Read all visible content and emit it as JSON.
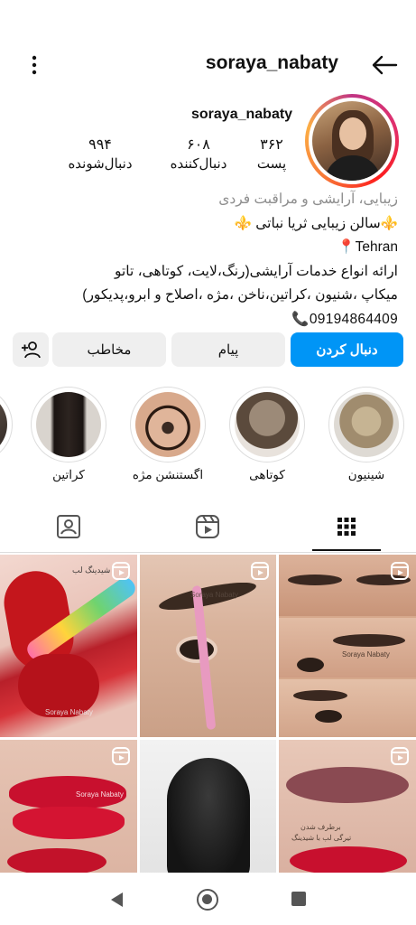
{
  "header": {
    "title": "soraya_nabaty",
    "menu_icon": "more-vertical-icon",
    "back_icon": "arrow-left-icon"
  },
  "profile": {
    "username": "soraya_nabaty",
    "stats": [
      {
        "value": "۳۶۲",
        "label": "پست"
      },
      {
        "value": "۶۰۸",
        "label": "دنبال‌کننده"
      },
      {
        "value": "۹۹۴",
        "label": "دنبال‌شونده"
      }
    ]
  },
  "bio": {
    "category": "زیبایی، آرایشی و مراقبت فردی",
    "line1": "⚜️سالن زیبایی ثریا نباتی ⚜️",
    "line2": "Tehran📍",
    "line3": "ارائه انواع خدمات آرایشی(رنگ،لایت، کوتاهی، تاتو",
    "line4": "میکاپ ،شنیون ،کراتین،ناخن ،مژه ،اصلاح و ابرو،پدیکور)",
    "phone": "09194864409📞"
  },
  "buttons": {
    "follow": "دنبال کردن",
    "message": "پیام",
    "contact": "مخاطب"
  },
  "highlights": [
    {
      "label": "شینیون"
    },
    {
      "label": "کوتاهی"
    },
    {
      "label": "اگستنشن مژه"
    },
    {
      "label": "کراتین"
    }
  ],
  "tabs": [
    {
      "icon": "grid-icon",
      "selected": true
    },
    {
      "icon": "reels-icon",
      "selected": false
    },
    {
      "icon": "tagged-icon",
      "selected": false
    }
  ],
  "posts": [
    {
      "caption": "شیدینگ لب",
      "watermark": "Soraya Nabaty"
    },
    {
      "watermark": "Soraya Nabaty"
    },
    {
      "watermark": "Soraya Nabaty"
    },
    {
      "watermark": "Soraya Nabaty"
    },
    {},
    {
      "caption_a": "برطرف شدن",
      "caption_b": "تیرگی لب با شیدینگ"
    }
  ],
  "colors": {
    "accent": "#0095f6",
    "button_bg": "#efefef",
    "muted_text": "#8e8e8e"
  }
}
